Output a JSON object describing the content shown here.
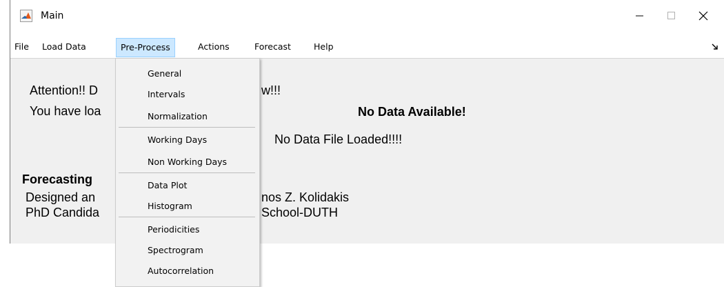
{
  "window": {
    "title": "Main"
  },
  "menu": {
    "items": [
      "File",
      "Load Data",
      "Pre-Process",
      "Actions",
      "Forecast",
      "Help"
    ],
    "active": "Pre-Process"
  },
  "preprocess_menu": {
    "items": [
      "General",
      "Intervals",
      "Normalization",
      "Working Days",
      "Non Working Days",
      "Data Plot",
      "Histogram",
      "Periodicities",
      "Spectrogram",
      "Autocorrelation"
    ]
  },
  "content": {
    "attention_fragment": "Attention!! D",
    "attention_tail": "w!!!",
    "loaded_fragment": "You have loa",
    "no_data_title": "No Data Available!",
    "no_file": "No Data File Loaded!!!!",
    "forecasting_fragment": "Forecasting",
    "designed_fragment": "Designed an",
    "author_tail": "nos Z. Kolidakis",
    "phd_fragment": "PhD Candida",
    "school_tail": "School-DUTH"
  },
  "colors": {
    "menu_active_bg": "#cce8ff",
    "menu_active_border": "#99d1ff",
    "content_bg": "#f0f0f0",
    "dropdown_bg": "#f2f2f2"
  },
  "icons": {
    "app": "matlab-icon",
    "minimize": "minimize-icon",
    "maximize": "maximize-icon",
    "close": "close-icon",
    "dock": "dock-arrow-icon"
  }
}
